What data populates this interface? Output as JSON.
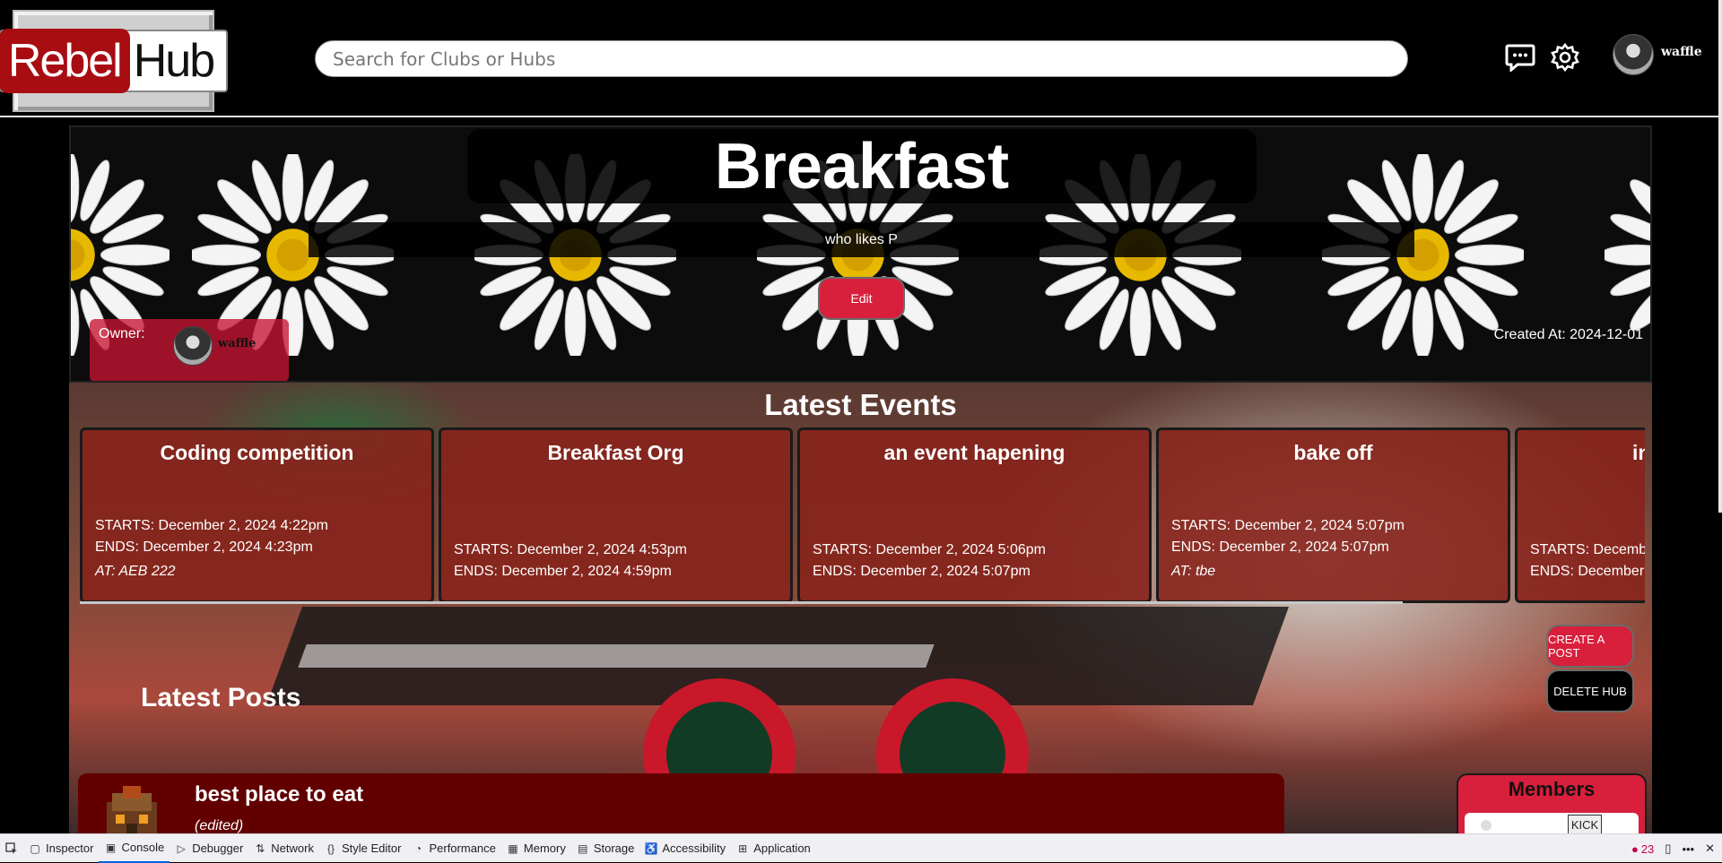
{
  "header": {
    "logo_rebel": "Rebel",
    "logo_hub": "Hub",
    "search_placeholder": "Search for Clubs or Hubs",
    "username": "waffle"
  },
  "hub": {
    "title": "Breakfast",
    "description": "who likes P",
    "edit_label": "Edit",
    "owner_label": "Owner:",
    "owner_name": "waffle",
    "created": "Created At: 2024-12-01"
  },
  "events": {
    "title": "Latest Events",
    "items": [
      {
        "title": "Coding competition",
        "starts": "STARTS: December 2, 2024 4:22pm",
        "ends": "ENDS: December 2, 2024 4:23pm",
        "at": "AT: AEB 222"
      },
      {
        "title": "Breakfast Org",
        "starts": "STARTS: December 2, 2024 4:53pm",
        "ends": "ENDS: December 2, 2024 4:59pm",
        "at": ""
      },
      {
        "title": "an event hapening",
        "starts": "STARTS: December 2, 2024 5:06pm",
        "ends": "ENDS: December 2, 2024 5:07pm",
        "at": ""
      },
      {
        "title": "bake off",
        "starts": "STARTS: December 2, 2024 5:07pm",
        "ends": "ENDS: December 2, 2024 5:07pm",
        "at": "AT: tbe"
      },
      {
        "title": "in",
        "starts": "STARTS: Decemb",
        "ends": "ENDS: December",
        "at": ""
      }
    ]
  },
  "actions": {
    "create_post": "CREATE A POST",
    "delete_hub": "DELETE HUB"
  },
  "posts": {
    "title": "Latest Posts",
    "items": [
      {
        "title": "best place to eat",
        "edited": "(edited)"
      }
    ]
  },
  "members": {
    "title": "Members",
    "kick_label": "KICK"
  },
  "devtools": {
    "tabs": [
      "Inspector",
      "Console",
      "Debugger",
      "Network",
      "Style Editor",
      "Performance",
      "Memory",
      "Storage",
      "Accessibility",
      "Application"
    ],
    "active_tab": "Console",
    "error_count": "23"
  },
  "colors": {
    "accent": "#d81f3c",
    "event_card": "#87241c",
    "post_card": "#620000",
    "logo_red": "#a80d12"
  }
}
